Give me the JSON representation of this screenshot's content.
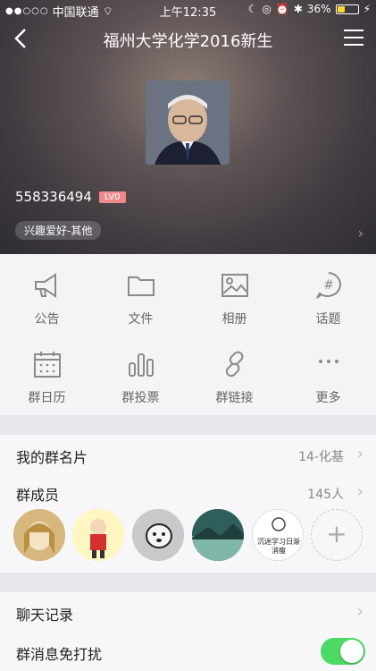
{
  "status": {
    "carrier": "中国联通",
    "time": "上午12:35",
    "battery": "36%"
  },
  "nav": {
    "title": "福州大学化学2016新生"
  },
  "group": {
    "id": "558336494",
    "level": "LV0",
    "tag": "兴趣爱好-其他"
  },
  "grid": [
    {
      "label": "公告",
      "icon": "megaphone-icon"
    },
    {
      "label": "文件",
      "icon": "folder-icon"
    },
    {
      "label": "相册",
      "icon": "image-icon"
    },
    {
      "label": "话题",
      "icon": "topic-hash-icon"
    },
    {
      "label": "群日历",
      "icon": "calendar-icon"
    },
    {
      "label": "群投票",
      "icon": "bar-chart-icon"
    },
    {
      "label": "群链接",
      "icon": "link-icon"
    },
    {
      "label": "更多",
      "icon": "more-dots-icon"
    }
  ],
  "rows": {
    "card": {
      "label": "我的群名片",
      "value": "14-化基"
    },
    "members": {
      "label": "群成员",
      "value": "145人"
    },
    "chat": {
      "label": "聊天记录"
    },
    "mute": {
      "label": "群消息免打扰",
      "on": true
    }
  },
  "member_avatars": [
    {
      "name": "member-avatar-1",
      "color": "#d7b77e"
    },
    {
      "name": "member-avatar-2",
      "color": "#ffe36b"
    },
    {
      "name": "member-avatar-3",
      "color": "#c9c9c9"
    },
    {
      "name": "member-avatar-4",
      "color": "#4d8c86"
    },
    {
      "name": "member-avatar-5",
      "color": "#ffffff",
      "text": "沉迷学习日渐消瘦"
    }
  ]
}
